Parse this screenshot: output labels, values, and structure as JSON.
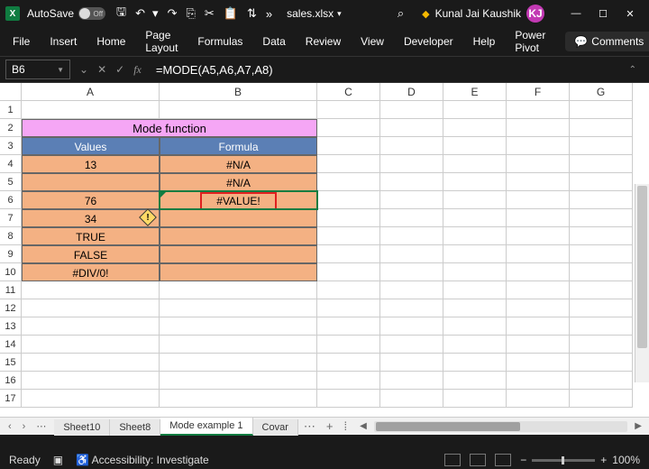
{
  "titlebar": {
    "autosave_label": "AutoSave",
    "autosave_state": "Off",
    "filename": "sales.xlsx",
    "user_name": "Kunal Jai Kaushik",
    "user_initials": "KJ"
  },
  "ribbon": {
    "tabs": [
      "File",
      "Insert",
      "Home",
      "Page Layout",
      "Formulas",
      "Data",
      "Review",
      "View",
      "Developer",
      "Help",
      "Power Pivot"
    ],
    "comments": "Comments"
  },
  "formula_bar": {
    "cell_ref": "B6",
    "formula": "=MODE(A5,A6,A7,A8)"
  },
  "columns": [
    "A",
    "B",
    "C",
    "D",
    "E",
    "F",
    "G"
  ],
  "rows": [
    "1",
    "2",
    "3",
    "4",
    "5",
    "6",
    "7",
    "8",
    "9",
    "10",
    "11",
    "12",
    "13",
    "14",
    "15",
    "16",
    "17"
  ],
  "sheet": {
    "title": "Mode function",
    "header_a": "Values",
    "header_b": "Formula",
    "a4": "13",
    "b4": "#N/A",
    "a5": "",
    "b5": "#N/A",
    "a6": "76",
    "b6": "#VALUE!",
    "a7": "34",
    "b7": "",
    "a8": "TRUE",
    "b8": "",
    "a9": "FALSE",
    "b9": "",
    "a10": "#DIV/0!",
    "b10": ""
  },
  "tabs": {
    "items": [
      "Sheet10",
      "Sheet8",
      "Mode example 1",
      "Covar"
    ],
    "active": 2
  },
  "status": {
    "ready": "Ready",
    "accessibility": "Accessibility: Investigate",
    "zoom": "100%"
  }
}
